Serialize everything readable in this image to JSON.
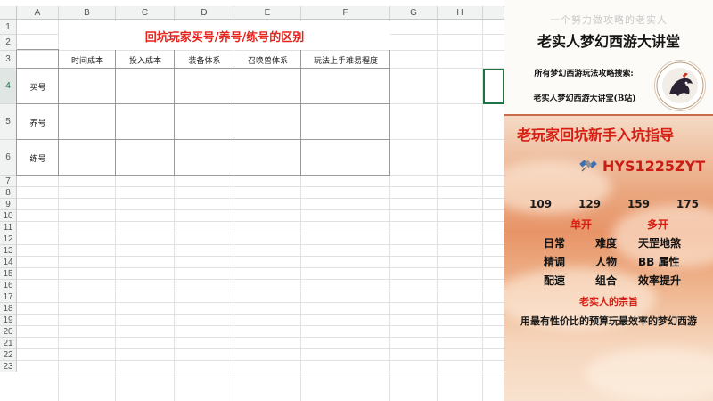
{
  "spreadsheet": {
    "columns": [
      "A",
      "B",
      "C",
      "D",
      "E",
      "F",
      "G",
      "H"
    ],
    "rows": [
      "1",
      "2",
      "3",
      "4",
      "5",
      "6",
      "7",
      "8",
      "9",
      "10",
      "11",
      "12",
      "13",
      "14",
      "15",
      "16",
      "17",
      "18",
      "19",
      "20",
      "21",
      "22",
      "23"
    ],
    "selected_row": "4",
    "title": "回坑玩家买号/养号/练号的区别",
    "headers": [
      "时间成本",
      "投入成本",
      "装备体系",
      "召唤兽体系",
      "玩法上手难易程度"
    ],
    "row_labels": [
      "买号",
      "养号",
      "练号"
    ]
  },
  "panel": {
    "watermark": "一个努力做攻略的老实人",
    "title": "老实人梦幻西游大讲堂",
    "search_label": "所有梦幻西游玩法攻略搜索:",
    "search_value": "老实人梦幻西游大讲堂(B站)",
    "guide_title": "老玩家回坑新手入坑指导",
    "contact_icon": "satellite-icon",
    "contact_id": "HYS1225ZYT",
    "levels": [
      "109",
      "129",
      "159",
      "175"
    ],
    "modes": [
      "单开",
      "多开"
    ],
    "topics": [
      [
        "日常",
        "难度",
        "天罡地煞"
      ],
      [
        "精调",
        "人物",
        "BB 属性"
      ],
      [
        "配速",
        "组合",
        "效率提升"
      ]
    ],
    "motto_title": "老实人的宗旨",
    "motto_text": "用最有性价比的预算玩最效率的梦幻西游",
    "accent_color": "#d81f14",
    "excel_green": "#217346"
  }
}
